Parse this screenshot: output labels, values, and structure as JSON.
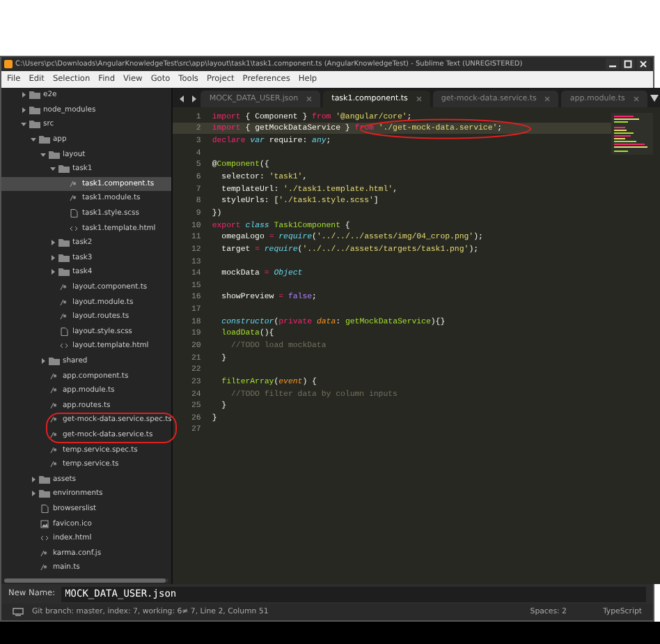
{
  "window": {
    "title": "C:\\Users\\pc\\Downloads\\AngularKnowledgeTest\\src\\app\\layout\\task1\\task1.component.ts (AngularKnowledgeTest) - Sublime Text (UNREGISTERED)"
  },
  "menu": [
    "File",
    "Edit",
    "Selection",
    "Find",
    "View",
    "Goto",
    "Tools",
    "Project",
    "Preferences",
    "Help"
  ],
  "sidebar": {
    "items": [
      {
        "name": "e2e",
        "kind": "folder",
        "expanded": false,
        "selected": false
      },
      {
        "name": "node_modules",
        "kind": "folder",
        "expanded": false,
        "selected": false
      },
      {
        "name": "src",
        "kind": "folder",
        "expanded": true,
        "selected": false,
        "children": [
          {
            "name": "app",
            "kind": "folder",
            "expanded": true,
            "selected": false,
            "children": [
              {
                "name": "layout",
                "kind": "folder",
                "expanded": true,
                "selected": false,
                "children": [
                  {
                    "name": "task1",
                    "kind": "folder",
                    "expanded": true,
                    "selected": false,
                    "children": [
                      {
                        "name": "task1.component.ts",
                        "kind": "script",
                        "selected": true
                      },
                      {
                        "name": "task1.module.ts",
                        "kind": "script",
                        "selected": false
                      },
                      {
                        "name": "task1.style.scss",
                        "kind": "doc",
                        "selected": false
                      },
                      {
                        "name": "task1.template.html",
                        "kind": "markup",
                        "selected": false
                      }
                    ]
                  },
                  {
                    "name": "task2",
                    "kind": "folder",
                    "expanded": false,
                    "selected": false
                  },
                  {
                    "name": "task3",
                    "kind": "folder",
                    "expanded": false,
                    "selected": false
                  },
                  {
                    "name": "task4",
                    "kind": "folder",
                    "expanded": false,
                    "selected": false
                  },
                  {
                    "name": "layout.component.ts",
                    "kind": "script",
                    "selected": false
                  },
                  {
                    "name": "layout.module.ts",
                    "kind": "script",
                    "selected": false
                  },
                  {
                    "name": "layout.routes.ts",
                    "kind": "script",
                    "selected": false
                  },
                  {
                    "name": "layout.style.scss",
                    "kind": "doc",
                    "selected": false
                  },
                  {
                    "name": "layout.template.html",
                    "kind": "markup",
                    "selected": false
                  }
                ]
              },
              {
                "name": "shared",
                "kind": "folder",
                "expanded": false,
                "selected": false
              },
              {
                "name": "app.component.ts",
                "kind": "script",
                "selected": false
              },
              {
                "name": "app.module.ts",
                "kind": "script",
                "selected": false
              },
              {
                "name": "app.routes.ts",
                "kind": "script",
                "selected": false
              },
              {
                "name": "get-mock-data.service.spec.ts",
                "kind": "script",
                "selected": false
              },
              {
                "name": "get-mock-data.service.ts",
                "kind": "script",
                "selected": false
              },
              {
                "name": "temp.service.spec.ts",
                "kind": "script",
                "selected": false
              },
              {
                "name": "temp.service.ts",
                "kind": "script",
                "selected": false
              }
            ]
          },
          {
            "name": "assets",
            "kind": "folder",
            "expanded": false,
            "selected": false
          },
          {
            "name": "environments",
            "kind": "folder",
            "expanded": false,
            "selected": false
          },
          {
            "name": "browserslist",
            "kind": "doc",
            "selected": false
          },
          {
            "name": "favicon.ico",
            "kind": "image",
            "selected": false
          },
          {
            "name": "index.html",
            "kind": "markup",
            "selected": false
          },
          {
            "name": "karma.conf.js",
            "kind": "script",
            "selected": false
          },
          {
            "name": "main.ts",
            "kind": "script",
            "selected": false
          }
        ]
      }
    ]
  },
  "tabs": [
    {
      "label": "MOCK_DATA_USER.json",
      "selected": false
    },
    {
      "label": "task1.component.ts",
      "selected": true
    },
    {
      "label": "get-mock-data.service.ts",
      "selected": false
    },
    {
      "label": "app.module.ts",
      "selected": false
    }
  ],
  "code": {
    "lines": [
      {
        "number": "1",
        "current": false,
        "tokens": [
          {
            "text": "import",
            "kind": "keyword"
          },
          {
            "text": " { Component } ",
            "kind": "plain"
          },
          {
            "text": "from",
            "kind": "keyword"
          },
          {
            "text": " '@angular/core'",
            "kind": "string"
          },
          {
            "text": ";",
            "kind": "plain"
          }
        ]
      },
      {
        "number": "2",
        "current": true,
        "tokens": [
          {
            "text": "import",
            "kind": "keyword"
          },
          {
            "text": " { getMockDataService } ",
            "kind": "plain"
          },
          {
            "text": "from",
            "kind": "keyword"
          },
          {
            "text": " './get-mock-data.service'",
            "kind": "string"
          },
          {
            "text": ";",
            "kind": "plain"
          }
        ]
      },
      {
        "number": "3",
        "current": false,
        "tokens": [
          {
            "text": "declare",
            "kind": "keyword"
          },
          {
            "text": " var",
            "kind": "type"
          },
          {
            "text": " require: ",
            "kind": "plain"
          },
          {
            "text": "any",
            "kind": "type"
          },
          {
            "text": ";",
            "kind": "plain"
          }
        ]
      },
      {
        "number": "4",
        "current": false
      },
      {
        "number": "5",
        "current": false,
        "tokens": [
          {
            "text": "@",
            "kind": "plain"
          },
          {
            "text": "Component",
            "kind": "function"
          },
          {
            "text": "({",
            "kind": "plain"
          }
        ]
      },
      {
        "number": "6",
        "current": false,
        "tokens": [
          {
            "text": "  selector: ",
            "kind": "plain"
          },
          {
            "text": "'task1'",
            "kind": "string"
          },
          {
            "text": ",",
            "kind": "plain"
          }
        ]
      },
      {
        "number": "7",
        "current": false,
        "tokens": [
          {
            "text": "  templateUrl: ",
            "kind": "plain"
          },
          {
            "text": "'./task1.template.html'",
            "kind": "string"
          },
          {
            "text": ",",
            "kind": "plain"
          }
        ]
      },
      {
        "number": "8",
        "current": false,
        "tokens": [
          {
            "text": "  styleUrls: [",
            "kind": "plain"
          },
          {
            "text": "'./task1.style.scss'",
            "kind": "string"
          },
          {
            "text": "]",
            "kind": "plain"
          }
        ]
      },
      {
        "number": "9",
        "current": false,
        "tokens": [
          {
            "text": "})",
            "kind": "plain"
          }
        ]
      },
      {
        "number": "10",
        "current": false,
        "tokens": [
          {
            "text": "export",
            "kind": "keyword"
          },
          {
            "text": " class",
            "kind": "type"
          },
          {
            "text": " Task1Component",
            "kind": "function"
          },
          {
            "text": " {",
            "kind": "plain"
          }
        ]
      },
      {
        "number": "11",
        "current": false,
        "tokens": [
          {
            "text": "  omegaLogo ",
            "kind": "plain"
          },
          {
            "text": "=",
            "kind": "keyword"
          },
          {
            "text": " require",
            "kind": "type"
          },
          {
            "text": "(",
            "kind": "plain"
          },
          {
            "text": "'../../../assets/img/04_crop.png'",
            "kind": "string"
          },
          {
            "text": ");",
            "kind": "plain"
          }
        ]
      },
      {
        "number": "12",
        "current": false,
        "tokens": [
          {
            "text": "  target ",
            "kind": "plain"
          },
          {
            "text": "=",
            "kind": "keyword"
          },
          {
            "text": " require",
            "kind": "type"
          },
          {
            "text": "(",
            "kind": "plain"
          },
          {
            "text": "'../../../assets/targets/task1.png'",
            "kind": "string"
          },
          {
            "text": ");",
            "kind": "plain"
          }
        ]
      },
      {
        "number": "13",
        "current": false
      },
      {
        "number": "14",
        "current": false,
        "tokens": [
          {
            "text": "  mockData ",
            "kind": "plain"
          },
          {
            "text": "=",
            "kind": "keyword"
          },
          {
            "text": " Object",
            "kind": "type"
          }
        ]
      },
      {
        "number": "15",
        "current": false
      },
      {
        "number": "16",
        "current": false,
        "tokens": [
          {
            "text": "  showPreview ",
            "kind": "plain"
          },
          {
            "text": "=",
            "kind": "keyword"
          },
          {
            "text": " false",
            "kind": "constant"
          },
          {
            "text": ";",
            "kind": "plain"
          }
        ]
      },
      {
        "number": "17",
        "current": false
      },
      {
        "number": "18",
        "current": false,
        "tokens": [
          {
            "text": "  constructor",
            "kind": "type"
          },
          {
            "text": "(",
            "kind": "plain"
          },
          {
            "text": "private",
            "kind": "keyword"
          },
          {
            "text": " data",
            "kind": "parameter"
          },
          {
            "text": ": ",
            "kind": "plain"
          },
          {
            "text": "getMockDataService",
            "kind": "function"
          },
          {
            "text": "){}",
            "kind": "plain"
          }
        ]
      },
      {
        "number": "19",
        "current": false,
        "tokens": [
          {
            "text": "  loadData",
            "kind": "function"
          },
          {
            "text": "(){",
            "kind": "plain"
          }
        ]
      },
      {
        "number": "20",
        "current": false,
        "tokens": [
          {
            "text": "    //TODO load mockData",
            "kind": "comment"
          }
        ]
      },
      {
        "number": "21",
        "current": false,
        "tokens": [
          {
            "text": "  }",
            "kind": "plain"
          }
        ]
      },
      {
        "number": "22",
        "current": false
      },
      {
        "number": "23",
        "current": false,
        "tokens": [
          {
            "text": "  filterArray",
            "kind": "function"
          },
          {
            "text": "(",
            "kind": "plain"
          },
          {
            "text": "event",
            "kind": "parameter"
          },
          {
            "text": ") {",
            "kind": "plain"
          }
        ]
      },
      {
        "number": "24",
        "current": false,
        "tokens": [
          {
            "text": "    //TODO filter data by column inputs",
            "kind": "comment"
          }
        ]
      },
      {
        "number": "25",
        "current": false,
        "tokens": [
          {
            "text": "  }",
            "kind": "plain"
          }
        ]
      },
      {
        "number": "26",
        "current": false,
        "tokens": [
          {
            "text": "}",
            "kind": "plain"
          }
        ]
      },
      {
        "number": "27",
        "current": false
      }
    ]
  },
  "input_panel": {
    "label": "New Name:",
    "value": "MOCK_DATA_USER.json"
  },
  "status_bar": {
    "git": "Git branch: master, index: 7, working: 6≠ 7, Line 2, Column 51",
    "spaces": "Spaces: 2",
    "syntax": "TypeScript"
  }
}
